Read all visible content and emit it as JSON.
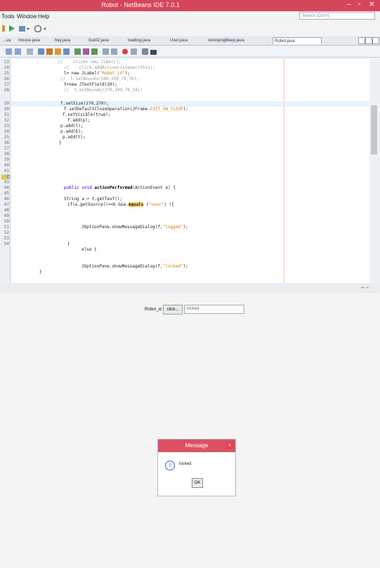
{
  "window": {
    "title": "Robot - NetBeans IDE 7.0.1"
  },
  "menu": {
    "items": [
      "Tools",
      "Window",
      "Help"
    ],
    "search_placeholder": "Search (Ctrl+I)"
  },
  "tabs": [
    {
      "label": "...va"
    },
    {
      "label": "mouse.java"
    },
    {
      "label": "hey.java"
    },
    {
      "label": "Gui02.java"
    },
    {
      "label": "loading.java"
    },
    {
      "label": "User.java"
    },
    {
      "label": "AnnoyingBeep.java"
    },
    {
      "label": "Robot.java"
    }
  ],
  "editor": {
    "lines": [
      {
        "n": "23"
      },
      {
        "n": "24"
      },
      {
        "n": "25"
      },
      {
        "n": "26"
      },
      {
        "n": "27"
      },
      {
        "n": "28"
      },
      {
        "n": "29"
      },
      {
        "n": "30"
      },
      {
        "n": "31"
      },
      {
        "n": "32"
      },
      {
        "n": "33"
      },
      {
        "n": "34"
      },
      {
        "n": "35"
      },
      {
        "n": "36"
      },
      {
        "n": "37"
      },
      {
        "n": "38"
      },
      {
        "n": "39"
      },
      {
        "n": "40"
      },
      {
        "n": "41"
      },
      {
        "n": "42"
      },
      {
        "n": "43"
      },
      {
        "n": "44"
      },
      {
        "n": "45"
      },
      {
        "n": "46"
      },
      {
        "n": "47"
      },
      {
        "n": "48"
      },
      {
        "n": "49"
      },
      {
        "n": "50"
      },
      {
        "n": "51"
      },
      {
        "n": "52"
      },
      {
        "n": "53"
      },
      {
        "n": "54"
      }
    ],
    "code": {
      "c23": "//    click= new Timer();",
      "c24": "//    click.addActionListener(this);",
      "c25a": "l= new JLabel(",
      "c25s": "\"Robot_id\"",
      "c25b": ");",
      "c26": "//  l.setBounds(200,200,70,70);",
      "c27": "t=new JTextField(20);",
      "c28": "//  t.setBounds(270,200,70,24);",
      "c29": "f.setSize(270,270);",
      "c30a": "f.setDefaultCloseOperation(JFrame.",
      "c30s": "EXIT_ON_CLOSE",
      "c30b": ");",
      "c31": "f.setVisible(true);",
      "c32": "f.add(p);",
      "c33": "p.add(l);",
      "c34": "p.add(b);",
      "c35": "p.add(t);",
      "c36": "}",
      "c40a": "public void ",
      "c40b": "actionPerformed",
      "c40c": "(ActionEvent e) {",
      "c42": "String a = t.getText();",
      "c43a": "if(e.getSource()==b &&a.",
      "c43b": "equals",
      "c43c": " (",
      "c43s": "\"user\"",
      "c43d": ") ){",
      "c46a": "JOptionPane.showMessageDialog(f,",
      "c46s": "\"logged\"",
      "c46b": ");",
      "c48": "}",
      "c49": "else {",
      "c51a": "JOptionPane.showMessageDialog(f,",
      "c51s": "\"locked\"",
      "c51b": ");",
      "c52": "}"
    }
  },
  "app": {
    "label": "Robot_id",
    "button": "click...",
    "field_value": "locked"
  },
  "dialog": {
    "title": "Message",
    "close": "x",
    "message": "locked",
    "ok": "OK",
    "icon": "info-icon"
  },
  "colors": {
    "title_bar": "#d6455a",
    "dialog_title": "#dc5262"
  }
}
